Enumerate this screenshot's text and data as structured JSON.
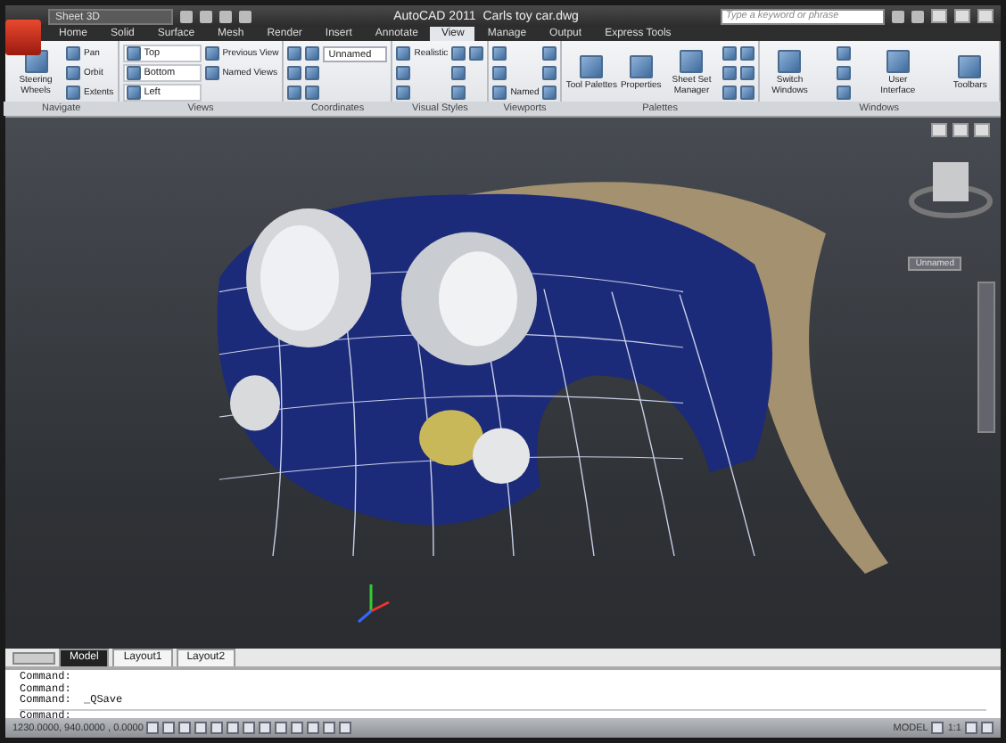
{
  "title_bar": {
    "workspace": "Sheet 3D",
    "title": "AutoCAD 2011",
    "file": "Carls toy car.dwg",
    "search": {
      "placeholder": "Type a keyword or phrase"
    }
  },
  "ribbon_tabs": [
    {
      "label": "Home",
      "selected": false
    },
    {
      "label": "Solid",
      "selected": false
    },
    {
      "label": "Surface",
      "selected": false
    },
    {
      "label": "Mesh",
      "selected": false
    },
    {
      "label": "Render",
      "selected": false
    },
    {
      "label": "Insert",
      "selected": false
    },
    {
      "label": "Annotate",
      "selected": false
    },
    {
      "label": "View",
      "selected": true
    },
    {
      "label": "Manage",
      "selected": false
    },
    {
      "label": "Output",
      "selected": false
    },
    {
      "label": "Express Tools",
      "selected": false
    }
  ],
  "ribbon_panels": [
    {
      "title": "Navigate",
      "items": [
        {
          "kind": "large",
          "label": "Steering Wheels"
        },
        {
          "kind": "small",
          "label": "Pan"
        },
        {
          "kind": "small",
          "label": "Orbit"
        },
        {
          "kind": "small",
          "label": "Extents"
        }
      ]
    },
    {
      "title": "Views",
      "items": [
        {
          "kind": "list",
          "label": "Top"
        },
        {
          "kind": "list",
          "label": "Bottom"
        },
        {
          "kind": "list",
          "label": "Left"
        },
        {
          "kind": "small",
          "label": "Previous View"
        },
        {
          "kind": "small",
          "label": "Named Views"
        }
      ]
    },
    {
      "title": "Coordinates",
      "items": [
        {
          "kind": "icon"
        },
        {
          "kind": "icon"
        },
        {
          "kind": "icon"
        },
        {
          "kind": "icon"
        },
        {
          "kind": "icon"
        },
        {
          "kind": "icon"
        },
        {
          "kind": "dropdown",
          "label": "Unnamed"
        }
      ]
    },
    {
      "title": "Visual Styles",
      "items": [
        {
          "kind": "small",
          "label": "Realistic"
        },
        {
          "kind": "icon"
        },
        {
          "kind": "icon"
        },
        {
          "kind": "icon"
        },
        {
          "kind": "icon"
        },
        {
          "kind": "icon"
        },
        {
          "kind": "icon"
        }
      ]
    },
    {
      "title": "Viewports",
      "items": [
        {
          "kind": "icon"
        },
        {
          "kind": "icon"
        },
        {
          "kind": "small",
          "label": "Named"
        },
        {
          "kind": "icon"
        },
        {
          "kind": "icon"
        },
        {
          "kind": "icon"
        }
      ]
    },
    {
      "title": "Palettes",
      "items": [
        {
          "kind": "large",
          "label": "Tool Palettes"
        },
        {
          "kind": "large",
          "label": "Properties"
        },
        {
          "kind": "large",
          "label": "Sheet Set Manager"
        },
        {
          "kind": "icon"
        },
        {
          "kind": "icon"
        },
        {
          "kind": "icon"
        },
        {
          "kind": "icon"
        },
        {
          "kind": "icon"
        },
        {
          "kind": "icon"
        }
      ]
    },
    {
      "title": "Windows",
      "items": [
        {
          "kind": "large",
          "label": "Switch Windows"
        },
        {
          "kind": "icon"
        },
        {
          "kind": "icon"
        },
        {
          "kind": "icon"
        },
        {
          "kind": "large",
          "label": "User Interface"
        },
        {
          "kind": "large",
          "label": "Toolbars"
        }
      ]
    }
  ],
  "viewport": {
    "view_label": "Unnamed"
  },
  "layout_tabs": [
    {
      "label": "Model",
      "selected": true
    },
    {
      "label": "Layout1",
      "selected": false
    },
    {
      "label": "Layout2",
      "selected": false
    }
  ],
  "command_history": [
    "Command:",
    "Command:",
    "Command:  _QSave"
  ],
  "command_prompt": "Command:",
  "status_bar": {
    "coordinates": "1230.0000, 940.0000 , 0.0000",
    "space": "MODEL",
    "scale": "1:1"
  }
}
